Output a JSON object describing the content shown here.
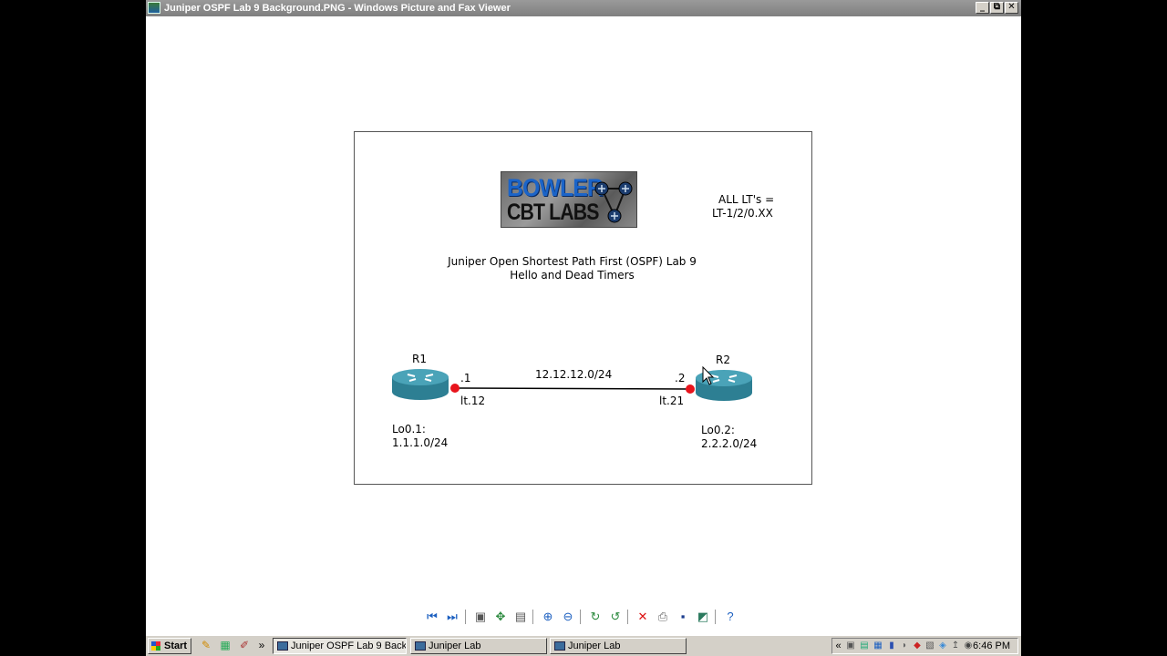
{
  "window": {
    "title": "Juniper OSPF Lab 9 Background.PNG - Windows Picture and Fax Viewer",
    "controls": {
      "minimize": "_",
      "maximize": "⧉",
      "close": "✕"
    }
  },
  "diagram": {
    "logo": {
      "line1": "BOWLER",
      "line2": "CBT LABS"
    },
    "lt_note": {
      "line1": "ALL LT's =",
      "line2": "LT-1/2/0.XX"
    },
    "title": {
      "line1": "Juniper Open Shortest Path First (OSPF) Lab 9",
      "line2": "Hello and Dead Timers"
    },
    "link_subnet": "12.12.12.0/24",
    "routers": [
      {
        "name": "R1",
        "addr": ".1",
        "interface": "lt.12",
        "loopback": "Lo0.1:",
        "loopback_net": "1.1.1.0/24"
      },
      {
        "name": "R2",
        "addr": ".2",
        "interface": "lt.21",
        "loopback": "Lo0.2:",
        "loopback_net": "2.2.2.0/24"
      }
    ],
    "colors": {
      "router_top": "#4aa3b8",
      "router_side": "#2d7f93",
      "link_endpoint": "#e8141c"
    }
  },
  "toolbar": {
    "icons": [
      "previous-image-icon",
      "next-image-icon",
      "best-fit-icon",
      "actual-size-icon",
      "slideshow-icon",
      "zoom-in-icon",
      "zoom-out-icon",
      "rotate-clockwise-icon",
      "rotate-counterclockwise-icon",
      "delete-icon",
      "print-icon",
      "save-icon",
      "open-with-icon",
      "help-icon"
    ]
  },
  "taskbar": {
    "start_label": "Start",
    "chevron": "»",
    "tasks": [
      {
        "label": "Juniper OSPF Lab 9 Back...",
        "active": true
      },
      {
        "label": "Juniper Lab",
        "active": false
      },
      {
        "label": "Juniper Lab",
        "active": false
      }
    ],
    "tray_expand": "«",
    "clock": "6:46 PM"
  }
}
